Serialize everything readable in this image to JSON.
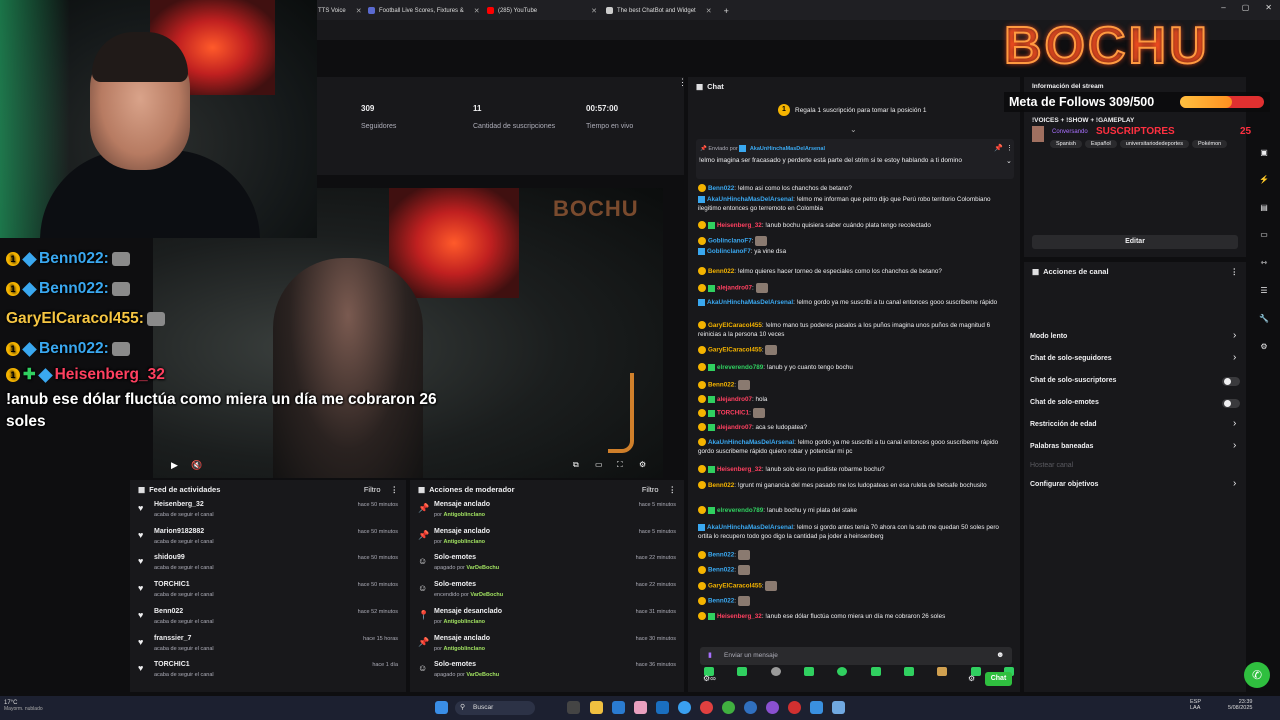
{
  "browser": {
    "tabs": [
      {
        "label": "TTS Voice",
        "color": "#7b5cff"
      },
      {
        "label": "Football Live Scores, Fixtures &",
        "color": "#5a6ad0"
      },
      {
        "label": "(285) YouTube",
        "color": "#ff0000"
      },
      {
        "label": "The best ChatBot and Widget",
        "color": "#cccccc"
      }
    ],
    "new_tab": "+",
    "window_controls": [
      "–",
      "▢",
      "✕"
    ]
  },
  "stats": {
    "followers_value": "309",
    "followers_label": "Seguidores",
    "subs_value": "11",
    "subs_label": "Cantidad de suscripciones",
    "live_value": "00:57:00",
    "live_label": "Tiempo en vivo"
  },
  "overlay": {
    "logo": "BOCHU",
    "follow_goal": "Meta de Follows 309/500",
    "follow_goal_progress": 0.618,
    "subs_label": "SUSCRIPTORES",
    "subs_count": "25",
    "chat": [
      {
        "user": "Benn022:",
        "user_color": "#3aa8f0",
        "text": ""
      },
      {
        "user": "Benn022:",
        "user_color": "#3aa8f0",
        "text": ""
      },
      {
        "user": "GaryElCaracol455:",
        "user_color": "#f5c542",
        "text": ""
      },
      {
        "user": "Benn022:",
        "user_color": "#3aa8f0",
        "text": ""
      },
      {
        "user": "Heisenberg_32",
        "user_color": "#ff4060",
        "text": "!anub ese dólar fluctúa como miera un día me cobraron 26 soles"
      }
    ]
  },
  "chat_panel": {
    "title": "Chat",
    "hype": "Regala 1 suscripción para tomar la posición 1",
    "hype_rank": "1",
    "pinned_by": "Enviado por",
    "pinned_user": "AkaUnHinchaMasDelArsenal",
    "pinned_text": "!elmo imagina ser fracasado y perderte está parte del strim si te estoy hablando a ti domino",
    "messages": [
      {
        "user": "Benn022",
        "color": "#3aa8f0",
        "text": ": !elmo asi como los chanchos de betano?"
      },
      {
        "user": "AkaUnHinchaMasDelArsenal",
        "color": "#3aa8f0",
        "text": ": !elmo me informan que petro dijo que Perú robo territorio Colombiano ilegitimo entonces go terremoto en Colombia"
      },
      {
        "user": "Heisenberg_32",
        "color": "#ff4060",
        "text": ": !anub bochu quisiera saber cuándo plata tengo recolectado"
      },
      {
        "user": "GoblinclanoF7",
        "color": "#3aa8f0",
        "text": ": "
      },
      {
        "user": "GoblinclanoF7",
        "color": "#3aa8f0",
        "text": ": ya vine dsa"
      },
      {
        "user": "Benn022",
        "color": "#f5b400",
        "text": ": !elmo quieres hacer torneo de especiales como los chanchos de betano?"
      },
      {
        "user": "alejandro07",
        "color": "#ff4060",
        "text": ": "
      },
      {
        "user": "AkaUnHinchaMasDelArsenal",
        "color": "#3aa8f0",
        "text": ": !elmo gordo ya me suscribi a tu canal entonces gooo suscribeme rápido"
      },
      {
        "user": "GaryElCaracol455",
        "color": "#f5b400",
        "text": ": !elmo mano tus poderes pasalos a los puños imagina unos puños de magnitud 6 reinicias a la persona 10 veces"
      },
      {
        "user": "GaryElCaracol455",
        "color": "#f5b400",
        "text": ": "
      },
      {
        "user": "elreverendo789",
        "color": "#30d060",
        "text": ": !anub y yo cuanto tengo bochu"
      },
      {
        "user": "Benn022",
        "color": "#f5b400",
        "text": ": "
      },
      {
        "user": "alejandro07",
        "color": "#ff4060",
        "text": ": hola"
      },
      {
        "user": "TORCHIC1",
        "color": "#ff4060",
        "text": ": "
      },
      {
        "user": "alejandro07",
        "color": "#ff4060",
        "text": ": aca se ludopatea?"
      },
      {
        "user": "AkaUnHinchaMasDelArsenal",
        "color": "#3aa8f0",
        "text": ": !elmo gordo ya me suscribi a tu canal entonces gooo suscribeme rápido gordo suscribeme rápido quiero robar y potenciar mi pc"
      },
      {
        "user": "Heisenberg_32",
        "color": "#ff4060",
        "text": ": !anub solo eso no pudiste robarme bochu?"
      },
      {
        "user": "Benn022",
        "color": "#f5b400",
        "text": ": !grunt mi ganancia del mes pasado me los ludopateas en esa ruleta de betsafe bochusito"
      },
      {
        "user": "elreverendo789",
        "color": "#30d060",
        "text": ": !anub bochu y mi plata del stake"
      },
      {
        "user": "AkaUnHinchaMasDelArsenal",
        "color": "#3aa8f0",
        "text": ": !elmo si gordo antes tenía 70 ahora con la sub me quedan 50 soles pero ortita lo recupero todo goo digo la cantidad pa joder a heinsenberg"
      },
      {
        "user": "Benn022",
        "color": "#3aa8f0",
        "text": ": "
      },
      {
        "user": "Benn022",
        "color": "#3aa8f0",
        "text": ": "
      },
      {
        "user": "GaryElCaracol455",
        "color": "#f5b400",
        "text": ": "
      },
      {
        "user": "Benn022",
        "color": "#3aa8f0",
        "text": ": "
      },
      {
        "user": "Heisenberg_32",
        "color": "#ff4060",
        "text": ": !anub ese dólar fluctúa como miera un día me cobraron 26 soles"
      }
    ],
    "input_placeholder": "Enviar un mensaje",
    "send_label": "Chat"
  },
  "activity_feed": {
    "title": "Feed de actividades",
    "filter": "Filtro",
    "items": [
      {
        "name": "Heisenberg_32",
        "action": "acaba de seguir el canal",
        "time": "hace 50 minutos"
      },
      {
        "name": "Marion9182882",
        "action": "acaba de seguir el canal",
        "time": "hace 50 minutos"
      },
      {
        "name": "shidou99",
        "action": "acaba de seguir el canal",
        "time": "hace 50 minutos"
      },
      {
        "name": "TORCHIC1",
        "action": "acaba de seguir el canal",
        "time": "hace 50 minutos"
      },
      {
        "name": "Benn022",
        "action": "acaba de seguir el canal",
        "time": "hace 52 minutos"
      },
      {
        "name": "franssier_7",
        "action": "acaba de seguir el canal",
        "time": "hace 15 horas"
      },
      {
        "name": "TORCHIC1",
        "action": "acaba de seguir el canal",
        "time": "hace 1 día"
      }
    ]
  },
  "mod_actions": {
    "title": "Acciones de moderador",
    "filter": "Filtro",
    "items": [
      {
        "name": "Mensaje anclado",
        "prefix": "por",
        "by": "Antigoblinclano",
        "time": "hace 5 minutos",
        "icon": "pin-icon"
      },
      {
        "name": "Mensaje anclado",
        "prefix": "por",
        "by": "Antigoblinclano",
        "time": "hace 5 minutos",
        "icon": "pin-icon"
      },
      {
        "name": "Solo-emotes",
        "prefix": "apagado por",
        "by": "VarDeBochu",
        "time": "hace 22 minutos",
        "icon": "emote-icon"
      },
      {
        "name": "Solo-emotes",
        "prefix": "encendido por",
        "by": "VarDeBochu",
        "time": "hace 22 minutos",
        "icon": "emote-icon"
      },
      {
        "name": "Mensaje desanclado",
        "prefix": "por",
        "by": "Antigoblinclano",
        "time": "hace 31 minutos",
        "icon": "unpin-icon"
      },
      {
        "name": "Mensaje anclado",
        "prefix": "por",
        "by": "Antigoblinclano",
        "time": "hace 30 minutos",
        "icon": "pin-icon"
      },
      {
        "name": "Solo-emotes",
        "prefix": "apagado por",
        "by": "VarDeBochu",
        "time": "hace 36 minutos",
        "icon": "emote-icon"
      }
    ]
  },
  "stream_info": {
    "title": "Información del stream",
    "stream_title": "!VOICES + !SHOW + !GAMEPLAY",
    "category": "Conversando",
    "tags": [
      "Spanish",
      "Español",
      "universitariodedeportes",
      "Pokémon"
    ],
    "edit": "Editar"
  },
  "channel_actions": {
    "title": "Acciones de canal",
    "items": [
      {
        "label": "Modo lento",
        "type": "chevron"
      },
      {
        "label": "Chat de solo-seguidores",
        "type": "chevron"
      },
      {
        "label": "Chat de solo-suscriptores",
        "type": "toggle"
      },
      {
        "label": "Chat de solo-emotes",
        "type": "toggle"
      },
      {
        "label": "Restricción de edad",
        "type": "chevron"
      },
      {
        "label": "Palabras baneadas",
        "type": "chevron"
      },
      {
        "label": "Hostear canal",
        "type": "disabled"
      },
      {
        "label": "Configurar objetivos",
        "type": "chevron"
      }
    ]
  },
  "taskbar": {
    "weather": "17°C",
    "weather_desc": "Mayorm. nublado",
    "search": "Buscar",
    "lang": "ESP",
    "lang2": "LAA",
    "time": "23:39",
    "date": "5/08/2025"
  }
}
